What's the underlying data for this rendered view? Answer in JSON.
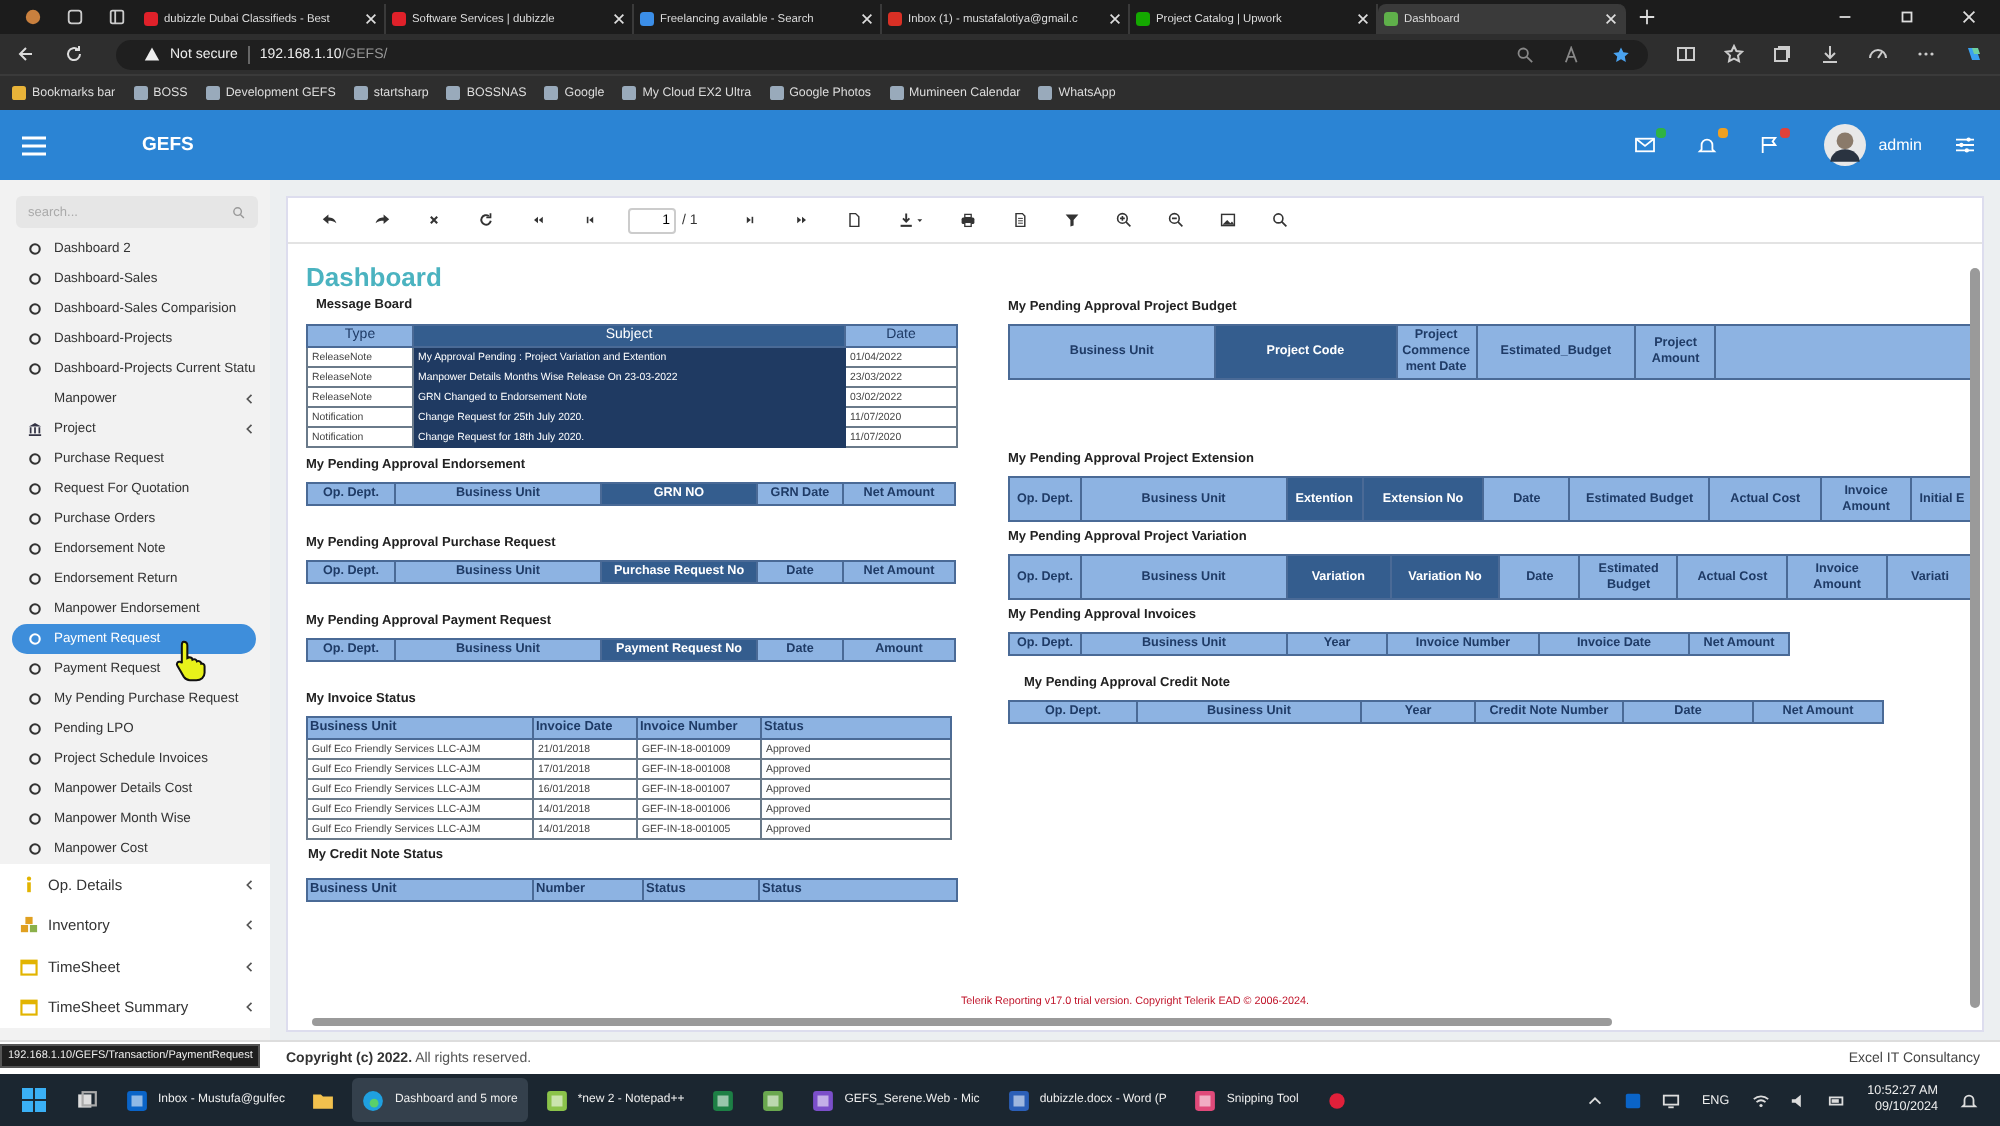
{
  "browser": {
    "tabs": [
      {
        "title": "dubizzle Dubai Classifieds - Best",
        "color": "#e0212a",
        "selected": false
      },
      {
        "title": "Software Services | dubizzle",
        "color": "#e0212a",
        "selected": false
      },
      {
        "title": "Freelancing available - Search",
        "color": "#3b8ee8",
        "selected": false
      },
      {
        "title": "Inbox (1) - mustafalotiya@gmail.c",
        "color": "#d93025",
        "selected": false
      },
      {
        "title": "Project Catalog | Upwork",
        "color": "#14a800",
        "selected": false
      },
      {
        "title": "Dashboard",
        "color": "#5fb04a",
        "selected": true
      }
    ],
    "security": "Not secure",
    "url_host": "192.168.1.10",
    "url_path": "/GEFS/",
    "bookmarks": [
      "Bookmarks bar",
      "BOSS",
      "Development GEFS",
      "startsharp",
      "BOSSNAS",
      "Google",
      "My Cloud EX2 Ultra",
      "Google Photos",
      "Mumineen Calendar",
      "WhatsApp"
    ]
  },
  "header": {
    "title": "GEFS",
    "notifications": [
      {
        "kind": "mail",
        "color": "#2fb344"
      },
      {
        "kind": "bell",
        "color": "#f0a020"
      },
      {
        "kind": "flag",
        "color": "#e0413a"
      }
    ],
    "user": "admin"
  },
  "sidebar": {
    "search": {
      "placeholder": "search..."
    },
    "items": [
      {
        "label": "Dashboard 2",
        "kind": "link",
        "selected": false
      },
      {
        "label": "Dashboard-Sales",
        "kind": "link",
        "selected": false
      },
      {
        "label": "Dashboard-Sales Comparision",
        "kind": "link",
        "selected": false
      },
      {
        "label": "Dashboard-Projects",
        "kind": "link",
        "selected": false
      },
      {
        "label": "Dashboard-Projects Current Statu",
        "kind": "link",
        "selected": false
      },
      {
        "label": "Manpower",
        "kind": "submenu",
        "selected": false
      },
      {
        "label": "Project",
        "kind": "project",
        "selected": false
      },
      {
        "label": "Purchase Request",
        "kind": "link",
        "selected": false
      },
      {
        "label": "Request For Quotation",
        "kind": "link",
        "selected": false
      },
      {
        "label": "Purchase Orders",
        "kind": "link",
        "selected": false
      },
      {
        "label": "Endorsement Note",
        "kind": "link",
        "selected": false
      },
      {
        "label": "Endorsement Return",
        "kind": "link",
        "selected": false
      },
      {
        "label": "Manpower Endorsement",
        "kind": "link",
        "selected": false
      },
      {
        "label": "Payment Request",
        "kind": "link",
        "selected": true
      },
      {
        "label": "Payment Request",
        "kind": "link",
        "selected": false
      },
      {
        "label": "My Pending Purchase Request",
        "kind": "link",
        "selected": false
      },
      {
        "label": "Pending LPO",
        "kind": "link",
        "selected": false
      },
      {
        "label": "Project Schedule Invoices",
        "kind": "link",
        "selected": false
      },
      {
        "label": "Manpower Details Cost",
        "kind": "link",
        "selected": false
      },
      {
        "label": "Manpower Month Wise",
        "kind": "link",
        "selected": false
      },
      {
        "label": "Manpower Cost",
        "kind": "link",
        "selected": false
      },
      {
        "label": "Op. Details",
        "kind": "info",
        "selected": false
      },
      {
        "label": "Inventory",
        "kind": "inventory",
        "selected": false
      },
      {
        "label": "TimeSheet",
        "kind": "calendar",
        "selected": false
      },
      {
        "label": "TimeSheet Summary",
        "kind": "calendar",
        "selected": false
      }
    ]
  },
  "report": {
    "page": "1",
    "total": "/ 1",
    "title": "Dashboard",
    "left_sections": [
      {
        "heading": "Message Board",
        "columns": [
          {
            "label": "Type",
            "dark": false
          },
          {
            "label": "Subject",
            "dark": true
          },
          {
            "label": "Date",
            "dark": false
          }
        ],
        "rows": [
          [
            "ReleaseNote",
            "My Approval Pending : Project Variation and Extention",
            "01/04/2022"
          ],
          [
            "ReleaseNote",
            "Manpower Details Months Wise Release On 23-03-2022",
            "23/03/2022"
          ],
          [
            "ReleaseNote",
            "GRN Changed to Endorsement Note",
            "03/02/2022"
          ],
          [
            "Notification",
            "Change Request for  25th  July 2020.",
            "11/07/2020"
          ],
          [
            "Notification",
            "Change Request for  18th July 2020.",
            "11/07/2020"
          ]
        ]
      },
      {
        "heading": "My Pending Approval Endorsement",
        "columns": [
          {
            "label": "Op. Dept.",
            "dark": false
          },
          {
            "label": "Business Unit",
            "dark": false
          },
          {
            "label": "GRN NO",
            "dark": true
          },
          {
            "label": "GRN Date",
            "dark": false
          },
          {
            "label": "Net Amount",
            "dark": false
          }
        ]
      },
      {
        "heading": "My Pending Approval Purchase Request",
        "columns": [
          {
            "label": "Op. Dept.",
            "dark": false
          },
          {
            "label": "Business Unit",
            "dark": false
          },
          {
            "label": "Purchase Request No",
            "dark": true
          },
          {
            "label": "Date",
            "dark": false
          },
          {
            "label": "Net Amount",
            "dark": false
          }
        ]
      },
      {
        "heading": "My Pending Approval Payment Request",
        "columns": [
          {
            "label": "Op. Dept.",
            "dark": false
          },
          {
            "label": "Business Unit",
            "dark": false
          },
          {
            "label": "Payment Request No",
            "dark": true
          },
          {
            "label": "Date",
            "dark": false
          },
          {
            "label": "Amount",
            "dark": false
          }
        ]
      },
      {
        "heading": "My Invoice Status",
        "columns": [
          {
            "label": "Business Unit",
            "dark": false
          },
          {
            "label": "Invoice Date",
            "dark": false
          },
          {
            "label": "Invoice Number",
            "dark": false
          },
          {
            "label": "Status",
            "dark": false
          }
        ],
        "rows": [
          [
            "Gulf Eco Friendly Services LLC-AJM",
            "21/01/2018",
            "GEF-IN-18-001009",
            "Approved"
          ],
          [
            "Gulf Eco Friendly Services LLC-AJM",
            "17/01/2018",
            "GEF-IN-18-001008",
            "Approved"
          ],
          [
            "Gulf Eco Friendly Services LLC-AJM",
            "16/01/2018",
            "GEF-IN-18-001007",
            "Approved"
          ],
          [
            "Gulf Eco Friendly Services LLC-AJM",
            "14/01/2018",
            "GEF-IN-18-001006",
            "Approved"
          ],
          [
            "Gulf Eco Friendly Services LLC-AJM",
            "14/01/2018",
            "GEF-IN-18-001005",
            "Approved"
          ]
        ]
      },
      {
        "heading": "My Credit Note Status",
        "columns": [
          {
            "label": "Business Unit",
            "dark": false
          },
          {
            "label": "Number",
            "dark": false
          },
          {
            "label": "Status",
            "dark": false
          },
          {
            "label": "Status",
            "dark": false
          }
        ]
      }
    ],
    "right_sections": [
      {
        "heading": "My Pending Approval Project Budget",
        "columns": [
          {
            "label": "Business Unit",
            "dark": false
          },
          {
            "label": "Project Code",
            "dark": true
          },
          {
            "label": "Project Commence ment Date",
            "dark": false
          },
          {
            "label": "Estimated_Budget",
            "dark": false
          },
          {
            "label": "Project Amount",
            "dark": false
          }
        ]
      },
      {
        "heading": "My Pending Approval Project Extension",
        "columns": [
          {
            "label": "Op. Dept.",
            "dark": false
          },
          {
            "label": "Business Unit",
            "dark": false
          },
          {
            "label": "Extention",
            "dark": true
          },
          {
            "label": "Extension No",
            "dark": true
          },
          {
            "label": "Date",
            "dark": false
          },
          {
            "label": "Estimated Budget",
            "dark": false
          },
          {
            "label": "Actual Cost",
            "dark": false
          },
          {
            "label": "Invoice Amount",
            "dark": false
          },
          {
            "label": "Initial E",
            "dark": false
          }
        ]
      },
      {
        "heading": "My Pending Approval Project Variation",
        "columns": [
          {
            "label": "Op. Dept.",
            "dark": false
          },
          {
            "label": "Business Unit",
            "dark": false
          },
          {
            "label": "Variation",
            "dark": true
          },
          {
            "label": "Variation No",
            "dark": true
          },
          {
            "label": "Date",
            "dark": false
          },
          {
            "label": "Estimated Budget",
            "dark": false
          },
          {
            "label": "Actual Cost",
            "dark": false
          },
          {
            "label": "Invoice Amount",
            "dark": false
          },
          {
            "label": "Variati",
            "dark": false
          }
        ]
      },
      {
        "heading": "My Pending Approval Invoices",
        "columns": [
          {
            "label": "Op. Dept.",
            "dark": false
          },
          {
            "label": "Business Unit",
            "dark": false
          },
          {
            "label": "Year",
            "dark": false
          },
          {
            "label": "Invoice Number",
            "dark": false
          },
          {
            "label": "Invoice Date",
            "dark": false
          },
          {
            "label": "Net Amount",
            "dark": false
          }
        ]
      },
      {
        "heading": "My Pending Approval Credit Note",
        "columns": [
          {
            "label": "Op. Dept.",
            "dark": false
          },
          {
            "label": "Business Unit",
            "dark": false
          },
          {
            "label": "Year",
            "dark": false
          },
          {
            "label": "Credit Note Number",
            "dark": false
          },
          {
            "label": "Date",
            "dark": false
          },
          {
            "label": "Net Amount",
            "dark": false
          }
        ]
      }
    ],
    "notice": "Telerik Reporting v17.0 trial version. Copyright Telerik EAD © 2006-2024."
  },
  "footer": {
    "copyright_bold": "Copyright (c) 2022.",
    "copyright_rest": "All rights reserved.",
    "company": "Excel IT Consultancy"
  },
  "status_url": "192.168.1.10/GEFS/Transaction/PaymentRequest",
  "taskbar": {
    "apps": [
      {
        "kind": "taskview",
        "selected": false
      },
      {
        "kind": "outlook",
        "label": "Inbox - Mustufa@gulfec",
        "selected": false
      },
      {
        "kind": "folder",
        "selected": false
      },
      {
        "kind": "edge",
        "label": "Dashboard and 5 more",
        "selected": true
      },
      {
        "kind": "notepad",
        "label": "*new 2 - Notepad++",
        "selected": false
      },
      {
        "kind": "excel",
        "selected": false
      },
      {
        "kind": "tool",
        "selected": false
      },
      {
        "kind": "vs",
        "label": "GEFS_Serene.Web - Mic",
        "selected": false
      },
      {
        "kind": "word",
        "label": "dubizzle.docx - Word (P",
        "selected": false
      },
      {
        "kind": "snip",
        "label": "Snipping Tool",
        "selected": false
      },
      {
        "kind": "record",
        "selected": false
      }
    ],
    "language": "ENG",
    "time": "10:52:27 AM",
    "date": "09/10/2024"
  }
}
